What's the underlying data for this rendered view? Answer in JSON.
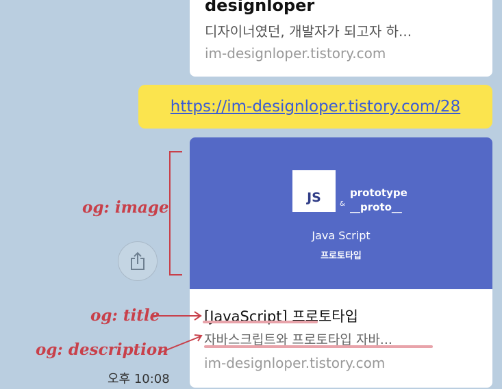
{
  "prev_card": {
    "title": "designloper",
    "description": "디자이너였던, 개발자가 되고자 하...",
    "domain": "im-designloper.tistory.com"
  },
  "message": {
    "link": "https://im-designloper.tistory.com/28"
  },
  "link_card": {
    "image": {
      "badge": "JS",
      "amp": "&",
      "line1": "prototype",
      "line2": "__proto__",
      "line3": "Java Script",
      "line4": "프로토타입"
    },
    "title": "[JavaScript] 프로토타입",
    "description": "자바스크립트와 프로토타입 자바...",
    "domain": "im-designloper.tistory.com"
  },
  "timestamp": "오후 10:08",
  "annotations": {
    "image": "og: image",
    "title": "og: title",
    "description": "og: description"
  },
  "colors": {
    "chat_bg": "#bacee0",
    "bubble": "#fbe44e",
    "og_image_bg": "#5469c6",
    "annotation": "#c8404a"
  }
}
